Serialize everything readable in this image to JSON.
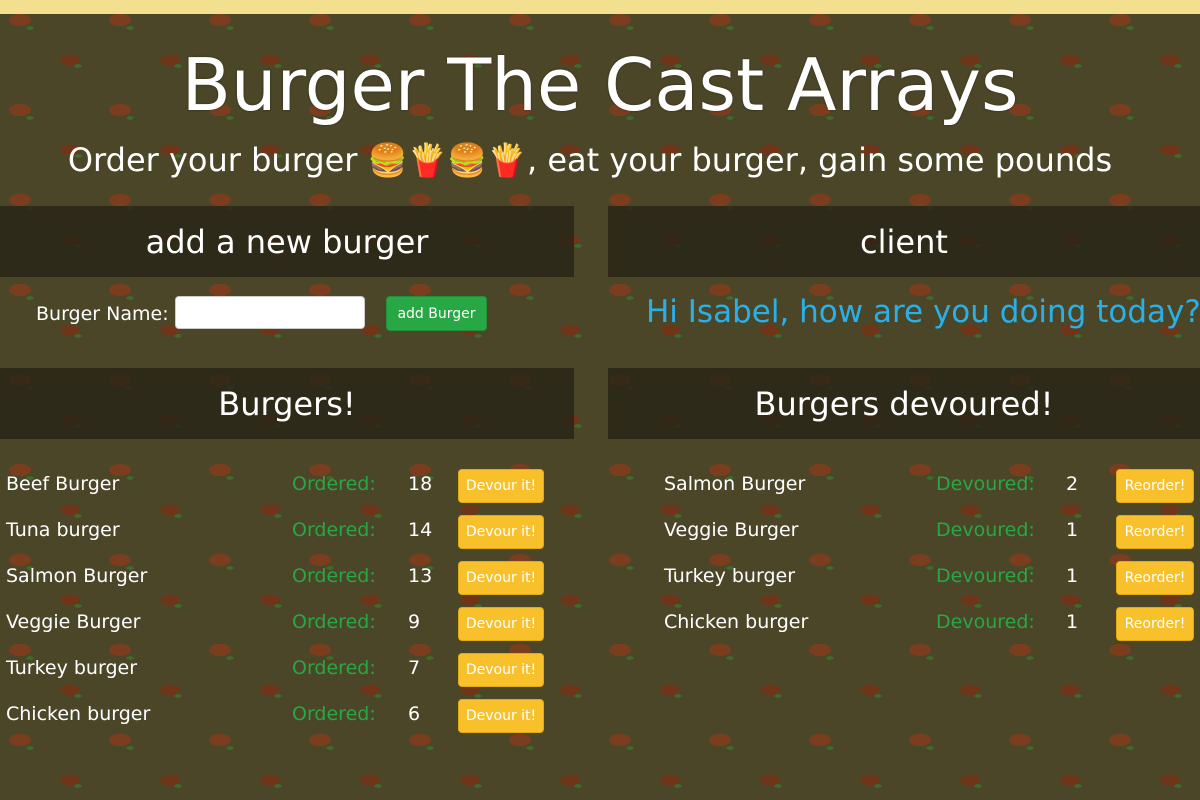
{
  "header": {
    "title": "Burger The Cast Arrays",
    "subtitle": "Order your burger 🍔🍟🍔🍟, eat your burger, gain some pounds"
  },
  "add_panel": {
    "heading": "add a new burger",
    "label": "Burger Name:",
    "input_value": "",
    "button_label": "add Burger"
  },
  "client_panel": {
    "heading": "client",
    "greeting": "Hi Isabel, how are you doing today?"
  },
  "burgers_panel": {
    "heading": "Burgers!",
    "status_label": "Ordered:",
    "button_label": "Devour it!",
    "items": [
      {
        "name": "Beef Burger",
        "count": "18"
      },
      {
        "name": "Tuna burger",
        "count": "14"
      },
      {
        "name": "Salmon Burger",
        "count": "13"
      },
      {
        "name": "Veggie Burger",
        "count": "9"
      },
      {
        "name": "Turkey burger",
        "count": "7"
      },
      {
        "name": "Chicken burger",
        "count": "6"
      }
    ]
  },
  "devoured_panel": {
    "heading": "Burgers devoured!",
    "status_label": "Devoured:",
    "button_label": "Reorder!",
    "items": [
      {
        "name": "Salmon Burger",
        "count": "2"
      },
      {
        "name": "Veggie Burger",
        "count": "1"
      },
      {
        "name": "Turkey burger",
        "count": "1"
      },
      {
        "name": "Chicken burger",
        "count": "1"
      }
    ]
  },
  "colors": {
    "background": "#4b4628",
    "accent_green": "#28a745",
    "accent_yellow": "#f8c12c",
    "greeting_blue": "#29b0e8"
  }
}
